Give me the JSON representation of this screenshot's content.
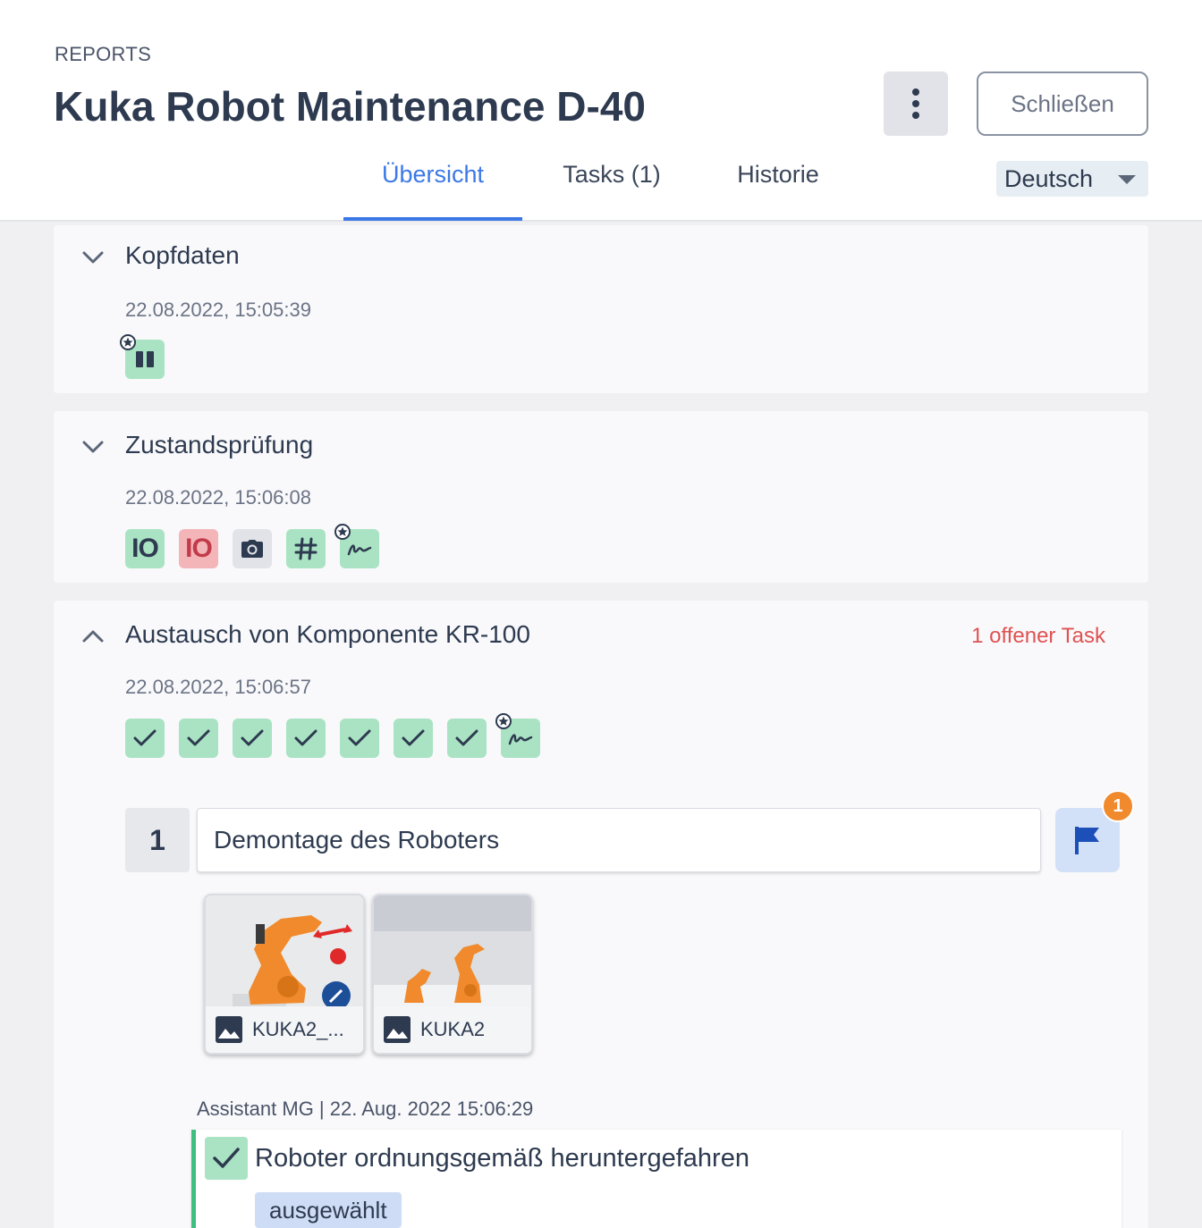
{
  "header": {
    "breadcrumb": "REPORTS",
    "title": "Kuka Robot Maintenance D-40",
    "more_icon": "more-vertical-icon",
    "close_label": "Schließen"
  },
  "tabs": [
    {
      "label": "Übersicht",
      "active": true
    },
    {
      "label": "Tasks (1)",
      "active": false
    },
    {
      "label": "Historie",
      "active": false
    }
  ],
  "language": {
    "selected": "Deutsch"
  },
  "sections": [
    {
      "title": "Kopfdaten",
      "date": "22.08.2022, 15:05:39",
      "expanded": true,
      "chips": [
        {
          "type": "pause-icon",
          "color": "green",
          "starred": true
        }
      ]
    },
    {
      "title": "Zustandsprüfung",
      "date": "22.08.2022, 15:06:08",
      "expanded": true,
      "chips": [
        {
          "type": "io-toggle",
          "label": "IO",
          "color": "green"
        },
        {
          "type": "io-toggle",
          "label": "IO",
          "color": "red"
        },
        {
          "type": "camera-icon",
          "color": "grey"
        },
        {
          "type": "hash-icon",
          "color": "green"
        },
        {
          "type": "signature-icon",
          "color": "green",
          "starred": true
        }
      ]
    },
    {
      "title": "Austausch von Komponente KR-100",
      "date": "22.08.2022, 15:06:57",
      "expanded": false,
      "open_tasks": "1 offener Task",
      "task": {
        "number": "1",
        "name": "Demontage des Roboters",
        "flag_count": "1",
        "attachments": [
          {
            "label": "KUKA2_..."
          },
          {
            "label": "KUKA2"
          }
        ],
        "meta": "Assistant MG | 22. Aug. 2022 15:06:29",
        "entry": {
          "title": "Roboter ordnungsgemäß heruntergefahren",
          "tag": "ausgewählt"
        }
      }
    }
  ],
  "colors": {
    "accent": "#3b78e7",
    "chip_green": "#a9e3c3",
    "chip_red": "#f4b5b9",
    "warning_text": "#e05252",
    "badge_orange": "#f08a2c",
    "entry_border": "#3fbf7f"
  }
}
